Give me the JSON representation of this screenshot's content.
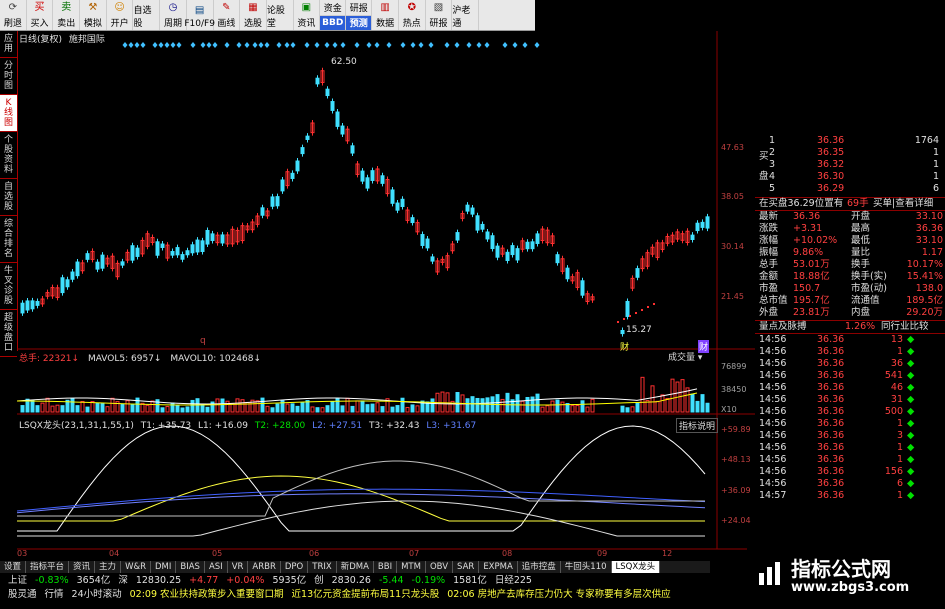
{
  "toolbar": {
    "buttons": [
      {
        "label": "刷退",
        "icon": "refresh-icon",
        "glyph": "⟳",
        "color": "#444"
      },
      {
        "label": "买入",
        "icon": "buy-icon",
        "glyph": "买",
        "color": "#d00000"
      },
      {
        "label": "卖出",
        "icon": "sell-icon",
        "glyph": "卖",
        "color": "#007000"
      },
      {
        "label": "模拟",
        "icon": "hammer-icon",
        "glyph": "⚒",
        "color": "#b06000"
      },
      {
        "label": "开户",
        "icon": "person-icon",
        "glyph": "☺",
        "color": "#d08000"
      },
      {
        "label": "自选股",
        "icon": "star-icon",
        "glyph": "★",
        "color": "#c00000"
      },
      {
        "label": "周期",
        "icon": "clock-icon",
        "glyph": "◷",
        "color": "#000080"
      },
      {
        "label": "F10/F9",
        "icon": "f10-icon",
        "glyph": "▤",
        "color": "#004080"
      },
      {
        "label": "画线",
        "icon": "pen-icon",
        "glyph": "✎",
        "color": "#c00000"
      },
      {
        "label": "选股",
        "icon": "select-icon",
        "glyph": "▦",
        "color": "#c00000"
      },
      {
        "label": "论股堂",
        "icon": "forum-icon",
        "glyph": "◉",
        "color": "#c00000"
      },
      {
        "label": "资讯",
        "icon": "news-icon",
        "glyph": "▣",
        "color": "#008000"
      }
    ],
    "groups": [
      {
        "top": "资金",
        "bottom": "BBD"
      },
      {
        "top": "研报",
        "bottom": "预测"
      }
    ],
    "buttons2": [
      {
        "label": "数据",
        "icon": "data-icon",
        "glyph": "▥",
        "color": "#c00000"
      },
      {
        "label": "热点",
        "icon": "hot-icon",
        "glyph": "✪",
        "color": "#c00000"
      },
      {
        "label": "研报",
        "icon": "report-icon",
        "glyph": "▧",
        "color": "#404040"
      },
      {
        "label": "沪老通",
        "icon": "hk-icon",
        "glyph": "⇄",
        "color": "#0050c0"
      }
    ]
  },
  "sidetabs": [
    "应用",
    "分时图",
    "K线图",
    "个股资料",
    "自选股",
    "综合排名",
    "牛叉诊股",
    "超级盘口"
  ],
  "chart": {
    "title": "日线(复权)",
    "stock_name": "施邦国际",
    "high_label": "62.50",
    "low_label": "15.27",
    "low_marker": "q",
    "price_ticks": [
      "47.63",
      "38.05",
      "30.14",
      "21.45"
    ],
    "markers": [
      "财",
      "财"
    ],
    "volume_legend": {
      "total": "总手: 22321",
      "ma5": "MAVOL5: 6957",
      "ma10": "MAVOL10: 102468"
    },
    "volume_tab": "成交量",
    "volume_ticks": [
      "76899",
      "38450",
      "X10"
    ],
    "indicator_legend": {
      "name": "LSQX龙头(23,1,31,1,55,1)",
      "t1": "T1: +35.73",
      "l1": "L1: +16.09",
      "t2": "T2: +28.00",
      "l2": "L2: +27.51",
      "t3": "T3: +32.43",
      "l3": "L3: +31.67"
    },
    "indicator_tab": "指标说明",
    "indicator_ticks": [
      "+59.89",
      "+48.13",
      "+36.09",
      "+24.04"
    ],
    "x_ticks": [
      "03",
      "04",
      "05",
      "06",
      "07",
      "08",
      "09",
      "12"
    ]
  },
  "quote": {
    "sell_rows": [
      {
        "label": "",
        "level": "1",
        "price": "36.36",
        "vol": "1764"
      },
      {
        "label": "",
        "level": "2",
        "price": "36.35",
        "vol": "1"
      },
      {
        "label": "",
        "level": "3",
        "price": "36.32",
        "vol": "1"
      },
      {
        "label": "",
        "level": "4",
        "price": "36.30",
        "vol": "1"
      },
      {
        "label": "",
        "level": "5",
        "price": "36.29",
        "vol": "6"
      }
    ],
    "sell_side_label": "买盘",
    "buy_info": "在买盘36.29位置有",
    "buy_info_vol": "69手",
    "buy_detail": "买单|查看详细",
    "stats": [
      {
        "l1": "最新",
        "v1": "36.36",
        "l2": "开盘",
        "v2": "33.10"
      },
      {
        "l1": "涨跌",
        "v1": "+3.31",
        "l2": "最高",
        "v2": "36.36"
      },
      {
        "l1": "涨幅",
        "v1": "+10.02%",
        "l2": "最低",
        "v2": "33.10"
      },
      {
        "l1": "振幅",
        "v1": "9.86%",
        "l2": "量比",
        "v2": "1.17"
      },
      {
        "l1": "总手",
        "v1": "53.01万",
        "l2": "换手",
        "v2": "10.17%"
      },
      {
        "l1": "金额",
        "v1": "18.88亿",
        "l2": "换手(实)",
        "v2": "15.41%"
      },
      {
        "l1": "市盈",
        "v1": "150.7",
        "l2": "市盈(动)",
        "v2": "138.0"
      },
      {
        "l1": "总市值",
        "v1": "195.7亿",
        "l2": "流通值",
        "v2": "189.5亿"
      },
      {
        "l1": "外盘",
        "v1": "23.81万",
        "l2": "内盘",
        "v2": "29.20万"
      }
    ],
    "ticks_header": {
      "left": "量点及脉搏",
      "pct": "1.26%",
      "right": "同行业比较"
    },
    "ticks": [
      {
        "time": "14:56",
        "price": "36.36",
        "vol": "13"
      },
      {
        "time": "14:56",
        "price": "36.36",
        "vol": "1"
      },
      {
        "time": "14:56",
        "price": "36.36",
        "vol": "36"
      },
      {
        "time": "14:56",
        "price": "36.36",
        "vol": "541"
      },
      {
        "time": "14:56",
        "price": "36.36",
        "vol": "46"
      },
      {
        "time": "14:56",
        "price": "36.36",
        "vol": "31"
      },
      {
        "time": "14:56",
        "price": "36.36",
        "vol": "500"
      },
      {
        "time": "14:56",
        "price": "36.36",
        "vol": "1"
      },
      {
        "time": "14:56",
        "price": "36.36",
        "vol": "3"
      },
      {
        "time": "14:56",
        "price": "36.36",
        "vol": "1"
      },
      {
        "time": "14:56",
        "price": "36.36",
        "vol": "1"
      },
      {
        "time": "14:56",
        "price": "36.36",
        "vol": "156"
      },
      {
        "time": "14:56",
        "price": "36.36",
        "vol": "6"
      },
      {
        "time": "14:57",
        "price": "36.36",
        "vol": "1"
      }
    ]
  },
  "bottom_tabs": [
    "设置",
    "指标平台",
    "资讯",
    "主力",
    "W&R",
    "DMI",
    "BIAS",
    "ASI",
    "VR",
    "ARBR",
    "DPO",
    "TRIX",
    "新DMA",
    "BBI",
    "MTM",
    "OBV",
    "SAR",
    "EXPMA",
    "追市控盘",
    "牛回头110",
    "LSQX龙头"
  ],
  "status": {
    "line1": [
      {
        "text": "上证",
        "cls": "white"
      },
      {
        "text": "-0.83%",
        "cls": "green"
      },
      {
        "text": "3654亿",
        "cls": "white"
      },
      {
        "text": "深",
        "cls": "white"
      },
      {
        "text": "12830.25",
        "cls": "white"
      },
      {
        "text": "+4.77",
        "cls": "red"
      },
      {
        "text": "+0.04%",
        "cls": "red"
      },
      {
        "text": "5935亿",
        "cls": "white"
      },
      {
        "text": "创",
        "cls": "white"
      },
      {
        "text": "2830.26",
        "cls": "white"
      },
      {
        "text": "-5.44",
        "cls": "green"
      },
      {
        "text": "-0.19%",
        "cls": "green"
      },
      {
        "text": "1581亿",
        "cls": "white"
      },
      {
        "text": "日经225",
        "cls": "white"
      }
    ],
    "line2": [
      {
        "text": "股灵通",
        "cls": "white"
      },
      {
        "text": "行情",
        "cls": "white"
      },
      {
        "text": "24小时滚动",
        "cls": "white"
      },
      {
        "text": "02:09 农业扶持政策步入重要窗口期",
        "cls": "yellow"
      },
      {
        "text": "近13亿元资金提前布局11只龙头股",
        "cls": "yellow"
      },
      {
        "text": "02:06 房地产去库存压力仍大 专家称要有多层次供应",
        "cls": "yellow"
      }
    ]
  },
  "watermark": {
    "title": "指标公式网",
    "url": "www.zbgs3.com"
  },
  "colors": {
    "up": "#ff3030",
    "down": "#40e0ff",
    "grid": "#8b0000",
    "ma1": "#ffffff",
    "ma2": "#ffff00"
  }
}
